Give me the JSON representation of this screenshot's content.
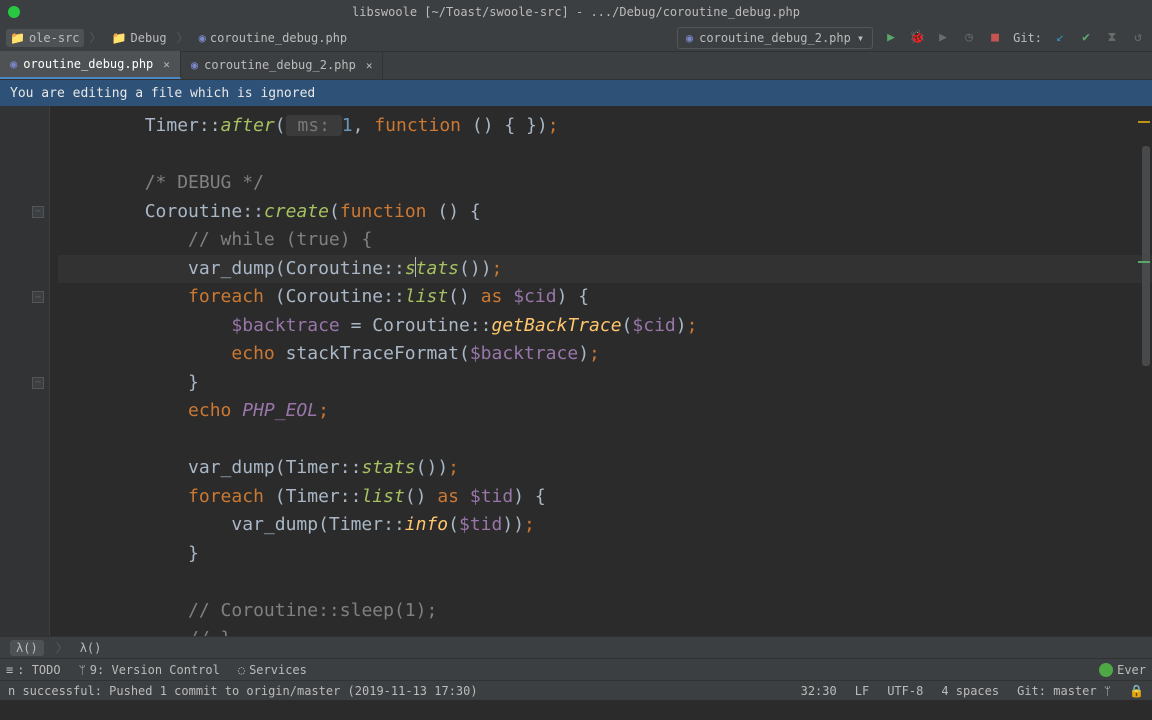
{
  "titlebar": {
    "text": "libswoole [~/Toast/swoole-src] - .../Debug/coroutine_debug.php"
  },
  "breadcrumbs": {
    "items": [
      {
        "label": "ole-src",
        "kind": "folder"
      },
      {
        "label": "Debug",
        "kind": "folder"
      },
      {
        "label": "coroutine_debug.php",
        "kind": "php"
      }
    ]
  },
  "run_config": {
    "label": "coroutine_debug_2.php"
  },
  "git": {
    "label": "Git:"
  },
  "tabs": {
    "items": [
      {
        "label": "oroutine_debug.php",
        "active": true
      },
      {
        "label": "coroutine_debug_2.php",
        "active": false
      }
    ]
  },
  "banner": {
    "text": "You are editing a file which is ignored"
  },
  "code": {
    "lines": [
      {
        "segments": [
          {
            "t": "        ",
            "c": "c-default"
          },
          {
            "t": "Timer",
            "c": "c-default"
          },
          {
            "t": "::",
            "c": "c-default"
          },
          {
            "t": "after",
            "c": "c-ident"
          },
          {
            "t": "(",
            "c": "c-default"
          },
          {
            "t": " ms: ",
            "c": "c-hint",
            "bg": true
          },
          {
            "t": "1",
            "c": "c-num"
          },
          {
            "t": ", ",
            "c": "c-default"
          },
          {
            "t": "function",
            "c": "c-keyword"
          },
          {
            "t": " () { })",
            "c": "c-default"
          },
          {
            "t": ";",
            "c": "c-keyword"
          }
        ]
      },
      {
        "segments": []
      },
      {
        "segments": [
          {
            "t": "        ",
            "c": "c-default"
          },
          {
            "t": "/* DEBUG */",
            "c": "c-comment"
          }
        ]
      },
      {
        "segments": [
          {
            "t": "        ",
            "c": "c-default"
          },
          {
            "t": "Coroutine",
            "c": "c-default"
          },
          {
            "t": "::",
            "c": "c-default"
          },
          {
            "t": "create",
            "c": "c-ident"
          },
          {
            "t": "(",
            "c": "c-default"
          },
          {
            "t": "function",
            "c": "c-keyword"
          },
          {
            "t": " () {",
            "c": "c-default"
          }
        ],
        "fold": true
      },
      {
        "segments": [
          {
            "t": "            ",
            "c": "c-default"
          },
          {
            "t": "// while (true) {",
            "c": "c-comment"
          }
        ]
      },
      {
        "hl": true,
        "segments": [
          {
            "t": "            ",
            "c": "c-default"
          },
          {
            "t": "var_dump(Corou",
            "c": "c-default"
          },
          {
            "t": "t",
            "c": "c-default",
            "caretbefore": false
          },
          {
            "t": "ine",
            "c": "c-default"
          },
          {
            "t": "::",
            "c": "c-default"
          },
          {
            "t": "s",
            "c": "c-ident",
            "caretafter": true
          },
          {
            "t": "tats",
            "c": "c-ident"
          },
          {
            "t": "())",
            "c": "c-default"
          },
          {
            "t": ";",
            "c": "c-keyword"
          }
        ]
      },
      {
        "segments": [
          {
            "t": "            ",
            "c": "c-default"
          },
          {
            "t": "foreach",
            "c": "c-keyword"
          },
          {
            "t": " (Coroutine",
            "c": "c-default"
          },
          {
            "t": "::",
            "c": "c-default"
          },
          {
            "t": "list",
            "c": "c-ident"
          },
          {
            "t": "() ",
            "c": "c-default"
          },
          {
            "t": "as",
            "c": "c-keyword"
          },
          {
            "t": " ",
            "c": "c-default"
          },
          {
            "t": "$cid",
            "c": "c-var"
          },
          {
            "t": ") {",
            "c": "c-default"
          }
        ],
        "fold": true
      },
      {
        "segments": [
          {
            "t": "                ",
            "c": "c-default"
          },
          {
            "t": "$backtrace",
            "c": "c-var"
          },
          {
            "t": " = Coroutine",
            "c": "c-default"
          },
          {
            "t": "::",
            "c": "c-default"
          },
          {
            "t": "getBackTrace",
            "c": "c-static"
          },
          {
            "t": "(",
            "c": "c-default"
          },
          {
            "t": "$cid",
            "c": "c-var"
          },
          {
            "t": ")",
            "c": "c-default"
          },
          {
            "t": ";",
            "c": "c-keyword"
          }
        ]
      },
      {
        "segments": [
          {
            "t": "                ",
            "c": "c-default"
          },
          {
            "t": "echo",
            "c": "c-keyword"
          },
          {
            "t": " stackTraceFormat(",
            "c": "c-default"
          },
          {
            "t": "$backtrace",
            "c": "c-var"
          },
          {
            "t": ")",
            "c": "c-default"
          },
          {
            "t": ";",
            "c": "c-keyword"
          }
        ]
      },
      {
        "segments": [
          {
            "t": "            }",
            "c": "c-default"
          }
        ],
        "foldend": true
      },
      {
        "segments": [
          {
            "t": "            ",
            "c": "c-default"
          },
          {
            "t": "echo",
            "c": "c-keyword"
          },
          {
            "t": " ",
            "c": "c-default"
          },
          {
            "t": "PHP_EOL",
            "c": "c-const"
          },
          {
            "t": ";",
            "c": "c-keyword"
          }
        ]
      },
      {
        "segments": []
      },
      {
        "segments": [
          {
            "t": "            ",
            "c": "c-default"
          },
          {
            "t": "var_dump(Timer",
            "c": "c-default"
          },
          {
            "t": "::",
            "c": "c-default"
          },
          {
            "t": "stats",
            "c": "c-ident"
          },
          {
            "t": "())",
            "c": "c-default"
          },
          {
            "t": ";",
            "c": "c-keyword"
          }
        ]
      },
      {
        "segments": [
          {
            "t": "            ",
            "c": "c-default"
          },
          {
            "t": "foreach",
            "c": "c-keyword"
          },
          {
            "t": " (Timer",
            "c": "c-default"
          },
          {
            "t": "::",
            "c": "c-default"
          },
          {
            "t": "list",
            "c": "c-ident"
          },
          {
            "t": "() ",
            "c": "c-default"
          },
          {
            "t": "as",
            "c": "c-keyword"
          },
          {
            "t": " ",
            "c": "c-default"
          },
          {
            "t": "$tid",
            "c": "c-var"
          },
          {
            "t": ") {",
            "c": "c-default"
          }
        ]
      },
      {
        "segments": [
          {
            "t": "                ",
            "c": "c-default"
          },
          {
            "t": "var_dump(Timer",
            "c": "c-default"
          },
          {
            "t": "::",
            "c": "c-default"
          },
          {
            "t": "info",
            "c": "c-static"
          },
          {
            "t": "(",
            "c": "c-default"
          },
          {
            "t": "$tid",
            "c": "c-var"
          },
          {
            "t": "))",
            "c": "c-default"
          },
          {
            "t": ";",
            "c": "c-keyword"
          }
        ]
      },
      {
        "segments": [
          {
            "t": "            }",
            "c": "c-default"
          }
        ]
      },
      {
        "segments": []
      },
      {
        "segments": [
          {
            "t": "            ",
            "c": "c-default"
          },
          {
            "t": "// Coroutine::sleep(1);",
            "c": "c-comment"
          }
        ]
      },
      {
        "segments": [
          {
            "t": "            ",
            "c": "c-default"
          },
          {
            "t": "// }",
            "c": "c-comment"
          }
        ]
      }
    ]
  },
  "crumbbar": {
    "items": [
      "λ()",
      "λ()"
    ]
  },
  "toolwindows": {
    "todo": {
      "label": "TODO",
      "shortcut": ": "
    },
    "vcs": {
      "label": "9: Version Control",
      "underline_key": "9"
    },
    "services": {
      "label": "Services"
    },
    "ever": {
      "label": "Ever"
    }
  },
  "statusbar": {
    "msg": "n successful: Pushed 1 commit to origin/master (2019-11-13 17:30)",
    "pos": "32:30",
    "sep": "LF",
    "enc": "UTF-8",
    "indent": "4 spaces",
    "branch_label": "Git:",
    "branch": "master"
  }
}
